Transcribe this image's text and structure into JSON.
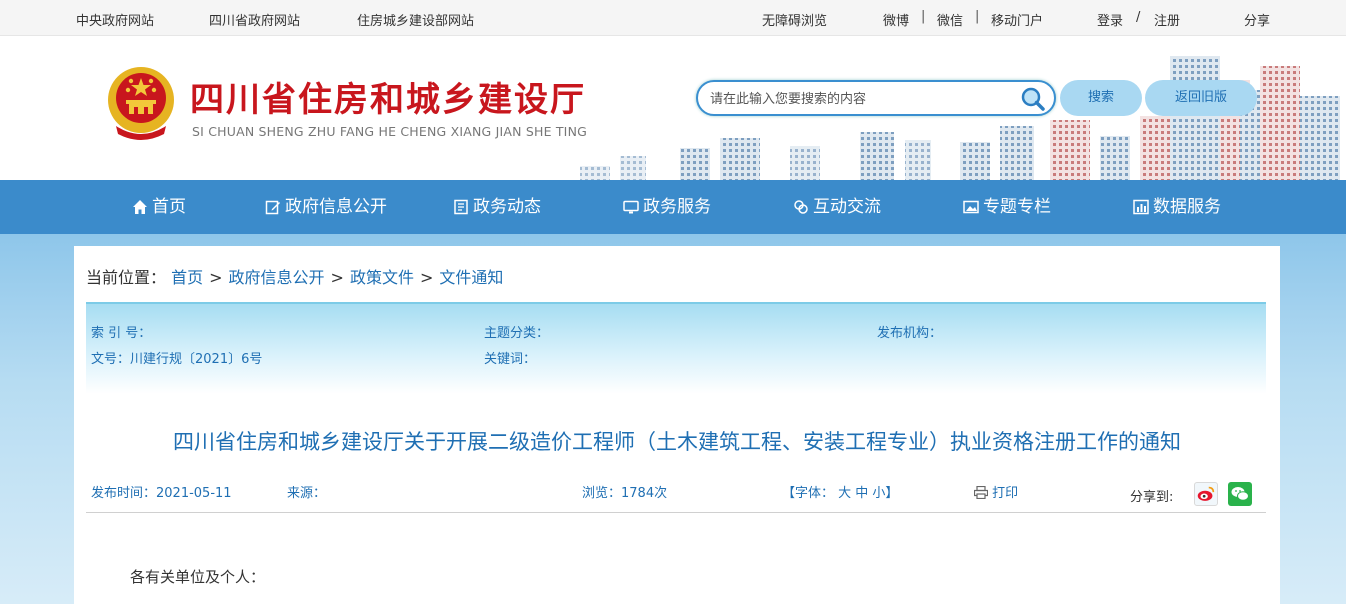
{
  "topbar": {
    "links_left": [
      "中央政府网站",
      "四川省政府网站",
      "住房城乡建设部网站"
    ],
    "accessible": "无障碍浏览",
    "weibo": "微博",
    "wechat": "微信",
    "mobile": "移动门户",
    "login": "登录",
    "slash": "/",
    "register": "注册",
    "share": "分享"
  },
  "header": {
    "title": "四川省住房和城乡建设厅",
    "subtitle": "SI CHUAN SHENG ZHU FANG HE CHENG XIANG JIAN SHE TING",
    "search_placeholder": "请在此输入您要搜索的内容",
    "search_button": "搜索",
    "old_version_button": "返回旧版"
  },
  "nav": {
    "items": [
      {
        "label": "首页",
        "icon": "home-icon"
      },
      {
        "label": "政府信息公开",
        "icon": "edit-icon"
      },
      {
        "label": "政务动态",
        "icon": "document-icon"
      },
      {
        "label": "政务服务",
        "icon": "monitor-icon"
      },
      {
        "label": "互动交流",
        "icon": "exchange-icon"
      },
      {
        "label": "专题专栏",
        "icon": "image-icon"
      },
      {
        "label": "数据服务",
        "icon": "chart-icon"
      }
    ]
  },
  "breadcrumb": {
    "prefix": "当前位置：",
    "items": [
      "首页",
      "政府信息公开",
      "政策文件",
      "文件通知"
    ],
    "separator": ">"
  },
  "meta": {
    "index_no": "索 引 号：",
    "topic": "主题分类：",
    "publisher": "发布机构：",
    "doc_no": "文号：川建行规〔2021〕6号",
    "keywords": "关键词："
  },
  "article": {
    "title": "四川省住房和城乡建设厅关于开展二级造价工程师（土木建筑工程、安装工程专业）执业资格注册工作的通知",
    "publish_time": "发布时间：2021-05-11",
    "source": "来源：",
    "views": "浏览：1784次",
    "font_size": "【字体： 大 中 小】",
    "print": "打印",
    "share_to": "分享到:",
    "body_first_line": "各有关单位及个人："
  },
  "colors": {
    "nav_bg": "#3b8bcb",
    "title_red": "#c8161d",
    "link_blue": "#1f6fb3"
  }
}
